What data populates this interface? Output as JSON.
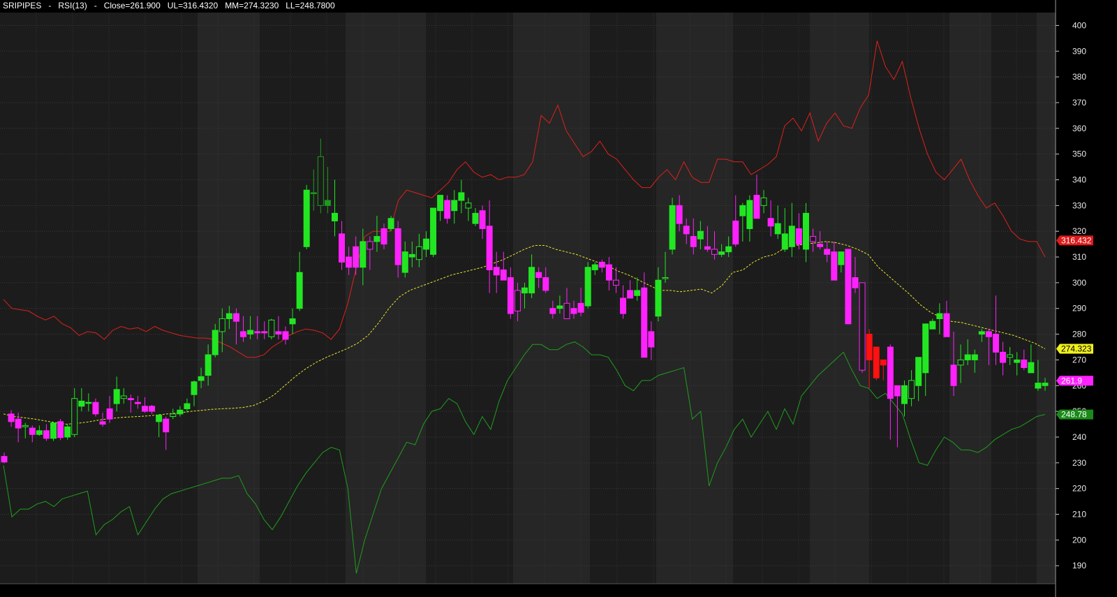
{
  "header": {
    "symbol": "SRIPIPES",
    "indicator": "RSI(13)",
    "close_text": "Close=261.900",
    "ul_text": "UL=316.4320",
    "mm_text": "MM=274.3230",
    "ll_text": "LL=248.7800"
  },
  "colors": {
    "background": "#000000",
    "plot_bg": "#1c1c1c",
    "band_bg": "#262626",
    "up": "#22e622",
    "up_strong": "#1f9a1f",
    "down": "#ff22ff",
    "down_strong": "#ff1111",
    "upper_line": "#e0201a",
    "middle_line": "#e8e830",
    "lower_line": "#1e9e1e"
  },
  "chart_data": {
    "type": "candlestick",
    "ylim": [
      183,
      405
    ],
    "yticks": [
      190,
      200,
      210,
      220,
      230,
      240,
      250,
      260,
      270,
      280,
      290,
      300,
      310,
      320,
      330,
      340,
      350,
      360,
      370,
      380,
      390,
      400
    ],
    "grid": true,
    "candles": [
      [
        232.5,
        234,
        229.8,
        230.3
      ],
      [
        249,
        250.5,
        244,
        246
      ],
      [
        247,
        249.5,
        238,
        243.5
      ],
      [
        244,
        245.5,
        239.5,
        244.5
      ],
      [
        243.5,
        244.5,
        238,
        241
      ],
      [
        241,
        244.5,
        240.5,
        242.5
      ],
      [
        242.5,
        245,
        238.5,
        239.5
      ],
      [
        239.5,
        246,
        238.5,
        245.5
      ],
      [
        246,
        247,
        238.8,
        239.8
      ],
      [
        240,
        245,
        239,
        244
      ],
      [
        241,
        259,
        240,
        255
      ],
      [
        252,
        259,
        250,
        254
      ],
      [
        253.5,
        257,
        250,
        253.5
      ],
      [
        253.5,
        255,
        248,
        249
      ],
      [
        246,
        249.5,
        244,
        245
      ],
      [
        251,
        256,
        245.5,
        247
      ],
      [
        253,
        263.5,
        250,
        258.5
      ],
      [
        255,
        259,
        253,
        256
      ],
      [
        255,
        256.5,
        249.5,
        254.5
      ],
      [
        253.5,
        256,
        251,
        253
      ],
      [
        252,
        255.5,
        249.5,
        250
      ],
      [
        252,
        252.5,
        249,
        250
      ],
      [
        246,
        249,
        240,
        248.5
      ],
      [
        247,
        248,
        235,
        242
      ],
      [
        248,
        251,
        247,
        249
      ],
      [
        249,
        252,
        248,
        250.5
      ],
      [
        251,
        255,
        249.5,
        253
      ],
      [
        256.5,
        262,
        252,
        261.5
      ],
      [
        262,
        267,
        259,
        263.5
      ],
      [
        264,
        276,
        260,
        272
      ],
      [
        272,
        284,
        271,
        281.5
      ],
      [
        281,
        290,
        273,
        286
      ],
      [
        286,
        291,
        282,
        288
      ],
      [
        288,
        290,
        276,
        285
      ],
      [
        281,
        287,
        277,
        279
      ],
      [
        280,
        287,
        278,
        281.5
      ],
      [
        281,
        287,
        278,
        280.5
      ],
      [
        281,
        285,
        278,
        280.5
      ],
      [
        279,
        286,
        278,
        285.5
      ],
      [
        281,
        287,
        278,
        280
      ],
      [
        281,
        283,
        276,
        278
      ],
      [
        284,
        290,
        280,
        286
      ],
      [
        290,
        312,
        289,
        304
      ],
      [
        314,
        338,
        313,
        336
      ],
      [
        335,
        344,
        328,
        335
      ],
      [
        349,
        356,
        327,
        330
      ],
      [
        330,
        345,
        327,
        332
      ],
      [
        324,
        340,
        318,
        327
      ],
      [
        319,
        324,
        305,
        308
      ],
      [
        310,
        314,
        303,
        306
      ],
      [
        314,
        318,
        303,
        306
      ],
      [
        306,
        321,
        299,
        316
      ],
      [
        316,
        318,
        305,
        313
      ],
      [
        316,
        326,
        312,
        318
      ],
      [
        321,
        323,
        313,
        315
      ],
      [
        321,
        326,
        320,
        325
      ],
      [
        321,
        324,
        302,
        307
      ],
      [
        304,
        316,
        302,
        312
      ],
      [
        310,
        316,
        306,
        311
      ],
      [
        309,
        319,
        306,
        314
      ],
      [
        313,
        320,
        310,
        317
      ],
      [
        311,
        328,
        310,
        329
      ],
      [
        328,
        333,
        324,
        334
      ],
      [
        332,
        334,
        323,
        325
      ],
      [
        328,
        336,
        323,
        332
      ],
      [
        332,
        340,
        327,
        335
      ],
      [
        329,
        333,
        324,
        331
      ],
      [
        323,
        329,
        322,
        327
      ],
      [
        328,
        330,
        317,
        321
      ],
      [
        322,
        332,
        296,
        305
      ],
      [
        306,
        312,
        296,
        303
      ],
      [
        305,
        312,
        302,
        301
      ],
      [
        302,
        306,
        286,
        288
      ],
      [
        297,
        300,
        285,
        289
      ],
      [
        296,
        300,
        290,
        298
      ],
      [
        296,
        311,
        294,
        306
      ],
      [
        304,
        306,
        298,
        302
      ],
      [
        302,
        306,
        296,
        297
      ],
      [
        290,
        293,
        286,
        288
      ],
      [
        290,
        295,
        288,
        291
      ],
      [
        292,
        298,
        287,
        286
      ],
      [
        290,
        293,
        286,
        288
      ],
      [
        292,
        298,
        287,
        288.5
      ],
      [
        291,
        308,
        290,
        306
      ],
      [
        305,
        308,
        303,
        307
      ],
      [
        308,
        309,
        304,
        306
      ],
      [
        307,
        310,
        297,
        301
      ],
      [
        301,
        306,
        296,
        299
      ],
      [
        294,
        299,
        286,
        288
      ],
      [
        297,
        301,
        294,
        294
      ],
      [
        295,
        302,
        293,
        297
      ],
      [
        298,
        304,
        285,
        271
      ],
      [
        281,
        285,
        270,
        275
      ],
      [
        287,
        306,
        285,
        301
      ],
      [
        302,
        312,
        300,
        302
      ],
      [
        313,
        333,
        311,
        330
      ],
      [
        330,
        334,
        320,
        323
      ],
      [
        322,
        325,
        315,
        319
      ],
      [
        318,
        325,
        311,
        314
      ],
      [
        317,
        324,
        313,
        320
      ],
      [
        314,
        322,
        312,
        313
      ],
      [
        313,
        320,
        309,
        311
      ],
      [
        311,
        315,
        310,
        312
      ],
      [
        312,
        318,
        310,
        314
      ],
      [
        324,
        334,
        314,
        315
      ],
      [
        326,
        331,
        316,
        330
      ],
      [
        321,
        334,
        316,
        332
      ],
      [
        334,
        342,
        325,
        325
      ],
      [
        330,
        336,
        327,
        333
      ],
      [
        325,
        332,
        318,
        322
      ],
      [
        319,
        330,
        317,
        323
      ],
      [
        313,
        329,
        312,
        319
      ],
      [
        314,
        331,
        310,
        322
      ],
      [
        321,
        327,
        313,
        315
      ],
      [
        313,
        331,
        308,
        327
      ],
      [
        318,
        321,
        312,
        316
      ],
      [
        315,
        320,
        313,
        314
      ],
      [
        313,
        316,
        308,
        311
      ],
      [
        312,
        316,
        302,
        301
      ],
      [
        307,
        310,
        304,
        312
      ],
      [
        313,
        311,
        289,
        284
      ],
      [
        302,
        310,
        296,
        298
      ],
      [
        300,
        298,
        265,
        266
      ],
      [
        280,
        282,
        259,
        270
      ],
      [
        275,
        274,
        262,
        263
      ],
      [
        270,
        270,
        262,
        268
      ],
      [
        275,
        276,
        239,
        255
      ],
      [
        260,
        260,
        236,
        256
      ],
      [
        253,
        262,
        248,
        260
      ],
      [
        255,
        266,
        252,
        262
      ],
      [
        260,
        270,
        254,
        271
      ],
      [
        265,
        283,
        256,
        284
      ],
      [
        282,
        286,
        282,
        285
      ],
      [
        286,
        292,
        280,
        288
      ],
      [
        288,
        293,
        280,
        279
      ],
      [
        268,
        281,
        256,
        260
      ],
      [
        268,
        276,
        261,
        270
      ],
      [
        270,
        278,
        268,
        272
      ],
      [
        270,
        274,
        265,
        272
      ],
      [
        280,
        282,
        277,
        281
      ],
      [
        281,
        282,
        268,
        279
      ],
      [
        280,
        295,
        268,
        273
      ],
      [
        273,
        277,
        264,
        269
      ],
      [
        271,
        275,
        268,
        272
      ],
      [
        269,
        273,
        264,
        270
      ],
      [
        270,
        274,
        266,
        267
      ],
      [
        265,
        276,
        265,
        269
      ],
      [
        259,
        270,
        258,
        261
      ],
      [
        260,
        263,
        258,
        261
      ]
    ],
    "series": [
      {
        "key": "UL",
        "values": [
          293.5,
          290,
          289.5,
          289,
          287,
          285.5,
          287,
          284,
          282.5,
          279.5,
          281,
          280.5,
          278,
          281.5,
          283,
          282,
          282.5,
          281,
          283,
          281.5,
          280.5,
          279.5,
          279,
          278.5,
          278.5,
          278,
          276.5,
          275,
          273,
          271,
          271,
          272,
          275,
          277,
          279.5,
          281,
          282,
          281.5,
          280.5,
          278,
          282,
          292,
          306,
          318,
          320,
          320,
          320,
          332,
          336,
          335,
          334,
          333,
          336,
          339,
          344,
          347,
          343,
          341,
          342,
          340,
          341,
          341,
          342,
          347,
          365,
          362,
          369,
          359,
          354,
          349,
          351,
          355,
          350,
          348,
          344,
          340,
          337,
          337,
          341,
          344,
          340,
          347,
          341,
          339,
          339,
          348,
          348,
          347,
          347,
          342,
          344,
          346,
          349,
          361,
          364,
          359,
          366,
          355,
          362,
          366,
          361,
          360,
          368,
          373,
          394,
          384,
          379,
          386,
          372,
          360,
          350,
          343,
          340,
          344,
          348,
          340,
          334,
          329,
          331,
          326,
          320,
          317,
          316,
          316,
          310
        ]
      },
      {
        "key": "MM",
        "values": [
          249,
          248,
          247.5,
          247,
          246.3,
          245.6,
          245,
          245.3,
          245.8,
          246.5,
          247.1,
          247.5,
          247.8,
          248,
          248.3,
          248.7,
          249.1,
          249.5,
          250,
          250.4,
          250.8,
          251,
          251.2,
          251.5,
          252.3,
          254,
          256.5,
          260,
          263.5,
          266.5,
          269,
          271,
          272.7,
          274.4,
          276.5,
          279.5,
          284.3,
          290,
          294.5,
          297,
          298.5,
          300,
          301.5,
          303,
          304,
          305,
          306,
          307.5,
          309,
          311,
          313,
          314.5,
          314.5,
          313,
          312,
          311,
          309.5,
          308,
          306.5,
          304.5,
          303,
          301,
          299,
          297,
          297,
          296.5,
          297,
          297.5,
          296,
          299,
          304,
          305,
          308,
          310,
          311,
          313.5,
          314.5,
          315,
          315.5,
          316,
          315.5,
          314.5,
          313,
          311,
          306,
          302.5,
          299,
          295.5,
          291.5,
          288.5,
          286.5,
          285,
          284.5,
          283.5,
          282.5,
          281.5,
          280.5,
          279.5,
          278,
          276.5,
          274.3
        ]
      },
      {
        "key": "LL",
        "values": [
          229,
          209,
          212,
          212,
          214,
          215,
          213,
          216,
          217,
          218,
          219,
          202,
          206,
          208,
          211,
          213,
          202,
          207,
          212,
          216,
          218,
          219,
          220,
          221,
          222,
          223,
          224,
          224,
          225,
          218,
          214,
          208,
          204,
          209,
          215,
          221,
          226,
          230,
          234,
          236,
          235,
          220,
          187,
          200,
          210,
          220,
          226,
          232,
          238,
          237,
          245,
          250,
          251,
          255,
          253,
          246,
          241,
          248,
          243,
          254,
          262,
          267,
          272,
          276,
          276,
          274,
          274,
          276,
          277,
          275,
          272,
          272,
          271,
          266,
          260,
          258,
          262,
          262,
          264,
          265,
          266,
          267,
          247,
          250,
          221,
          230,
          236,
          243,
          247,
          240,
          245,
          250,
          243,
          251,
          245,
          256,
          260,
          264,
          267,
          270,
          273,
          266,
          260,
          259,
          255,
          257,
          253,
          249,
          239,
          230,
          229,
          235,
          240,
          238,
          235,
          235,
          234,
          236,
          239,
          241,
          243,
          244,
          246,
          248,
          248.8
        ]
      }
    ],
    "series_x": [
      [
        0,
        1,
        2,
        3,
        4,
        5,
        6,
        7,
        8,
        9,
        10,
        11,
        12,
        13,
        14,
        15,
        16,
        17,
        18,
        19,
        20,
        21,
        22,
        23,
        24,
        25,
        26,
        27,
        28,
        29,
        30,
        31,
        32,
        33,
        34,
        35,
        36,
        37,
        38,
        39,
        40,
        41,
        42,
        43,
        44,
        45,
        46,
        47,
        48,
        49,
        50,
        51,
        52,
        53,
        54,
        55,
        56,
        57,
        58,
        59,
        60,
        61,
        62,
        63,
        64,
        65,
        66,
        67,
        68,
        69,
        70,
        71,
        72,
        73,
        74,
        75,
        76,
        77,
        78,
        79,
        80,
        81,
        82,
        83,
        84,
        85,
        86,
        87,
        88,
        89,
        90,
        91,
        92,
        93,
        94,
        95,
        96,
        97,
        98,
        99,
        100,
        101,
        102,
        103,
        104,
        105,
        106,
        107,
        108,
        109,
        110,
        111,
        112,
        113,
        114,
        115,
        116,
        117,
        118,
        119,
        120,
        121,
        122,
        123,
        124,
        125,
        126
      ],
      "stepped",
      "stepped"
    ],
    "last_values": {
      "UL": "316.432",
      "MM": "274.323",
      "Close": "261.9",
      "LL": "248.78"
    }
  }
}
